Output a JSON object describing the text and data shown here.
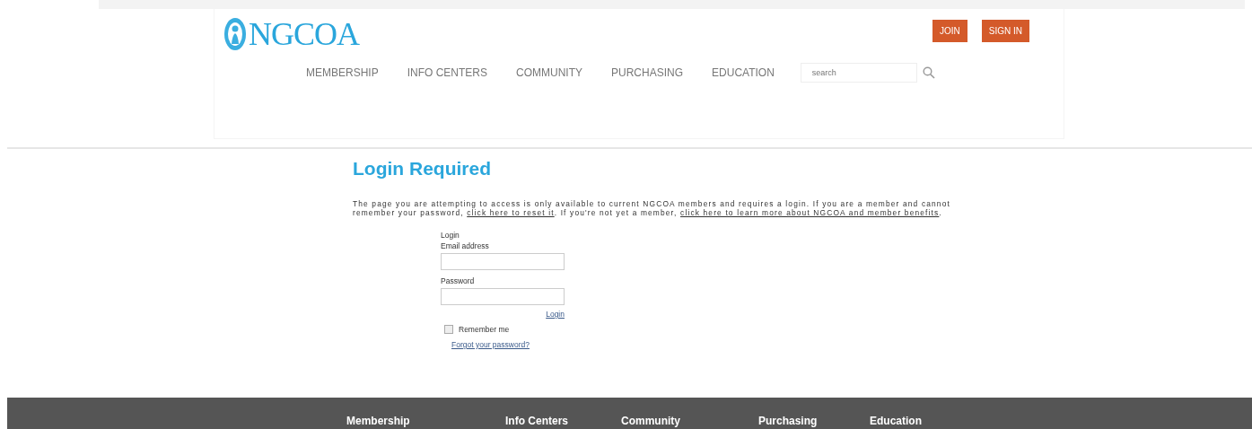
{
  "header": {
    "logo": "NGCOA",
    "buttons": [
      "JOIN",
      "SIGN IN"
    ],
    "nav": [
      "MEMBERSHIP",
      "INFO CENTERS",
      "COMMUNITY",
      "PURCHASING",
      "EDUCATION"
    ],
    "search": {
      "placeholder": "search"
    }
  },
  "main": {
    "title": "Login Required",
    "message": [
      {
        "kind": "text",
        "text": "The page you are attempting to access is only available to current NGCOA members and requires a login. If you are a member and cannot remember your password, "
      },
      {
        "kind": "link",
        "text": "click here to reset it"
      },
      {
        "kind": "text",
        "text": ". If you're not yet a member, "
      },
      {
        "kind": "link",
        "text": "click here to learn more about NGCOA and member benefits"
      },
      {
        "kind": "text",
        "text": "."
      }
    ],
    "form": {
      "heading": "Login",
      "email_label": "Email address",
      "password_label": "Password",
      "submit": "Login",
      "remember": {
        "label": "Remember me",
        "checked": false
      },
      "forgot": "Forgot your password?"
    }
  },
  "footer": {
    "nav": [
      "Membership",
      "Info Centers",
      "Community",
      "Purchasing",
      "Education"
    ]
  }
}
